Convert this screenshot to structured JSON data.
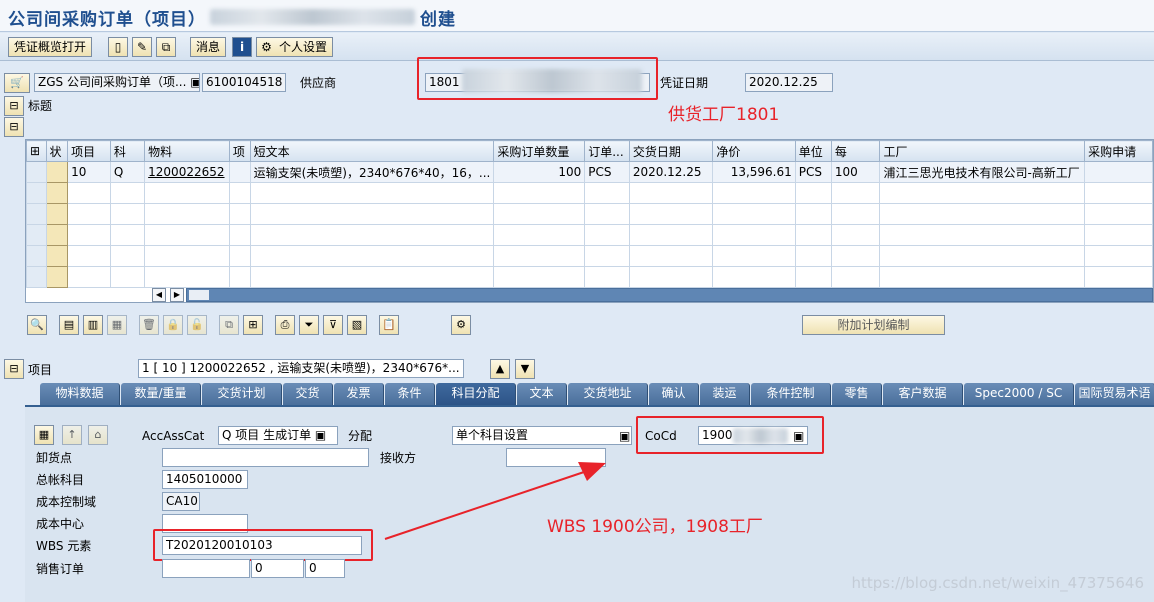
{
  "window": {
    "title_prefix": "公司间采购订单（项目）",
    "title_suffix": "创建"
  },
  "toolbar": {
    "voucher_overview": "凭证概览打开",
    "messages": "消息",
    "personal_settings": "个人设置"
  },
  "header": {
    "order_type": "ZGS 公司间采购订单（项...",
    "order_number": "6100104518",
    "vendor_label": "供应商",
    "vendor_value": "1801",
    "doc_date_label": "凭证日期",
    "doc_date_value": "2020.12.25",
    "header_label": "标题"
  },
  "annotations": {
    "supply_plant": "供货工厂1801",
    "wbs_note": "WBS 1900公司，1908工厂"
  },
  "grid": {
    "columns": [
      "状",
      "项目",
      "科",
      "物料",
      "项",
      "短文本",
      "采购订单数量",
      "订单...",
      "交货日期",
      "净价",
      "单位",
      "每",
      "工厂",
      "采购申请"
    ],
    "row": {
      "item": "10",
      "acct": "Q",
      "material": "1200022652",
      "short_text": "运输支架(未喷塑)，2340*676*40，16，...",
      "qty": "100",
      "order_unit": "PCS",
      "delivery_date": "2020.12.25",
      "net_price": "13,596.61",
      "unit": "PCS",
      "per": "100",
      "plant": "浦江三思光电技术有限公司-高新工厂",
      "pr": ""
    }
  },
  "buttons": {
    "additional_planning": "附加计划编制"
  },
  "item_section": {
    "label": "项目",
    "selector_value": "1 [ 10 ] 1200022652 , 运输支架(未喷塑)，2340*676*..."
  },
  "tabs": [
    "物料数据",
    "数量/重量",
    "交货计划",
    "交货",
    "发票",
    "条件",
    "科目分配",
    "文本",
    "交货地址",
    "确认",
    "装运",
    "条件控制",
    "零售",
    "客户数据",
    "Spec2000 / SC",
    "国际贸易术语"
  ],
  "active_tab": "科目分配",
  "acct_assignment": {
    "accasscat_label": "AccAssCat",
    "accasscat_value": "Q 项目 生成订单",
    "distribution_label": "分配",
    "distribution_value": "单个科目设置",
    "cocd_label": "CoCd",
    "cocd_value": "1900",
    "unloading_point_label": "卸货点",
    "recipient_label": "接收方",
    "gl_account_label": "总帐科目",
    "gl_account_value": "1405010000",
    "co_area_label": "成本控制域",
    "co_area_value": "CA10",
    "cost_center_label": "成本中心",
    "wbs_label": "WBS 元素",
    "wbs_value": "T2020120010103",
    "sales_order_label": "销售订单",
    "sales_order_item": "0",
    "sales_order_sched": "0"
  },
  "watermark": "https://blog.csdn.net/weixin_47375646"
}
